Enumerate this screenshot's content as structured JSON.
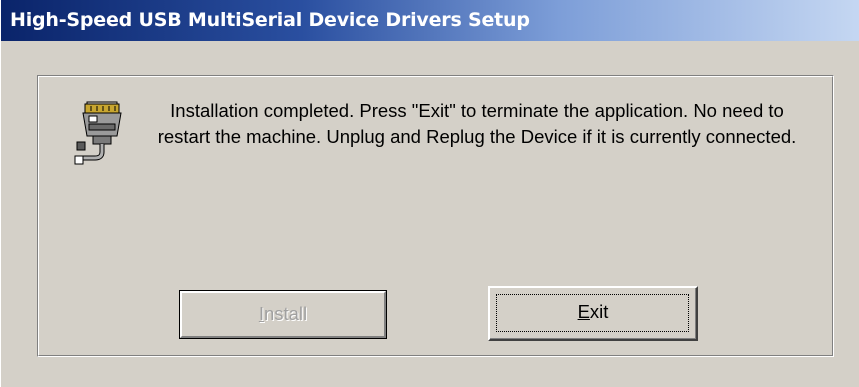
{
  "window": {
    "title": "High-Speed USB MultiSerial Device Drivers Setup"
  },
  "icons": {
    "app": "usb-connector-icon"
  },
  "message": "Installation completed. Press \"Exit\" to terminate the application. No need to restart the machine. Unplug and Replug the Device if it is currently connected.",
  "buttons": {
    "install": {
      "mnemonic": "I",
      "rest": "nstall",
      "enabled": false
    },
    "exit": {
      "mnemonic": "E",
      "rest": "xit",
      "enabled": true,
      "focused": true
    }
  },
  "colors": {
    "face": "#d4d0c8",
    "title_start": "#0a246a",
    "title_end": "#c5d7f2",
    "disabled_text": "#a0a0a0"
  }
}
